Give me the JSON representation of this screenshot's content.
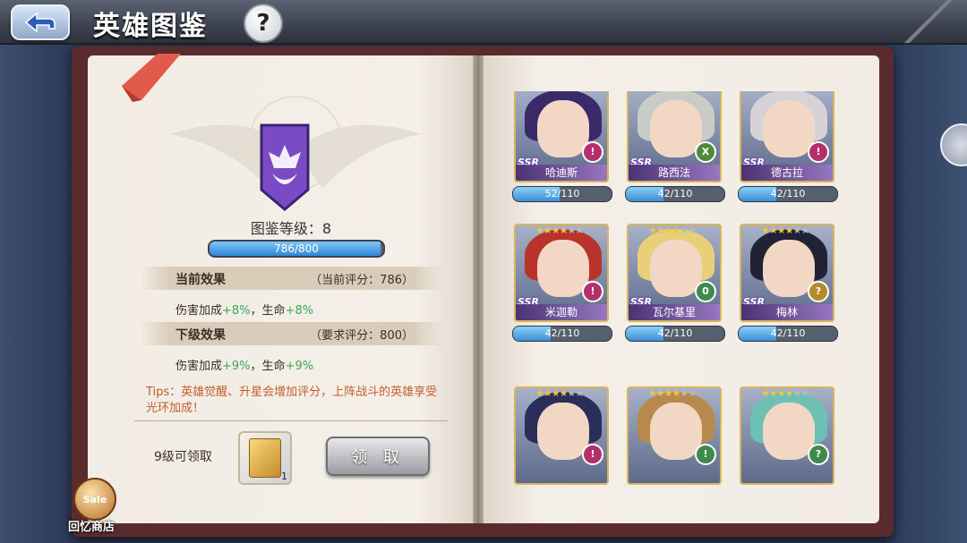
{
  "header": {
    "title": "英雄图鉴",
    "help_label": "?"
  },
  "codex": {
    "level_label": "图鉴等级：8",
    "exp_text": "786/800",
    "exp_fraction": 0.9825,
    "current": {
      "title": "当前效果",
      "score": "（当前评分：786）",
      "prefix": "伤害加成",
      "dmg": "+8%",
      "mid": "，生命",
      "hp": "+8%"
    },
    "next": {
      "title": "下级效果",
      "score": "（要求评分：800）",
      "prefix": "伤害加成",
      "dmg": "+9%",
      "mid": "，生命",
      "hp": "+9%"
    },
    "tips": "Tips：英雄觉醒、升星会增加评分，上阵战斗的英雄享受光环加成！",
    "claim_level": "9级可领取",
    "reward_count": "1",
    "claim_button": "领 取"
  },
  "shop": {
    "badge": "Sale",
    "label": "回忆商店"
  },
  "colors": {
    "accent_green": "#38a85a",
    "tips_orange": "#c35e2a"
  },
  "heroes": [
    {
      "name": "哈迪斯",
      "rarity": "SSR",
      "progress": "52/110",
      "ratio": 0.4727,
      "stars": 0,
      "role": "!",
      "role_color": "#b4306a",
      "hair": "#3a2a6a"
    },
    {
      "name": "路西法",
      "rarity": "SSR",
      "progress": "42/110",
      "ratio": 0.3818,
      "stars": 0,
      "role": "X",
      "role_color": "#4f8a3a",
      "hair": "#c9ccc6"
    },
    {
      "name": "德古拉",
      "rarity": "SSR",
      "progress": "42/110",
      "ratio": 0.3818,
      "stars": 0,
      "role": "!",
      "role_color": "#b4306a",
      "hair": "#d6d2d8"
    },
    {
      "name": "米迦勒",
      "rarity": "SSR",
      "progress": "42/110",
      "ratio": 0.3818,
      "stars": 4,
      "role": "!",
      "role_color": "#b4306a",
      "hair": "#b8342a"
    },
    {
      "name": "瓦尔基里",
      "rarity": "SSR",
      "progress": "42/110",
      "ratio": 0.3818,
      "stars": 4,
      "role": "0",
      "role_color": "#3f8a4a",
      "hair": "#e8cf7a"
    },
    {
      "name": "梅林",
      "rarity": "SSR",
      "progress": "42/110",
      "ratio": 0.3818,
      "stars": 4,
      "role": "?",
      "role_color": "#b58a2a",
      "hair": "#222236"
    },
    {
      "name": "",
      "rarity": "",
      "progress": "",
      "ratio": 0,
      "stars": 4,
      "role": "!",
      "role_color": "#b4306a",
      "hair": "#2b2e5a"
    },
    {
      "name": "",
      "rarity": "",
      "progress": "",
      "ratio": 0,
      "stars": 4,
      "role": "!",
      "role_color": "#3f8a4a",
      "hair": "#b7894d"
    },
    {
      "name": "",
      "rarity": "",
      "progress": "",
      "ratio": 0,
      "stars": 4,
      "role": "?",
      "role_color": "#3f8a4a",
      "hair": "#6cc0b4"
    }
  ]
}
